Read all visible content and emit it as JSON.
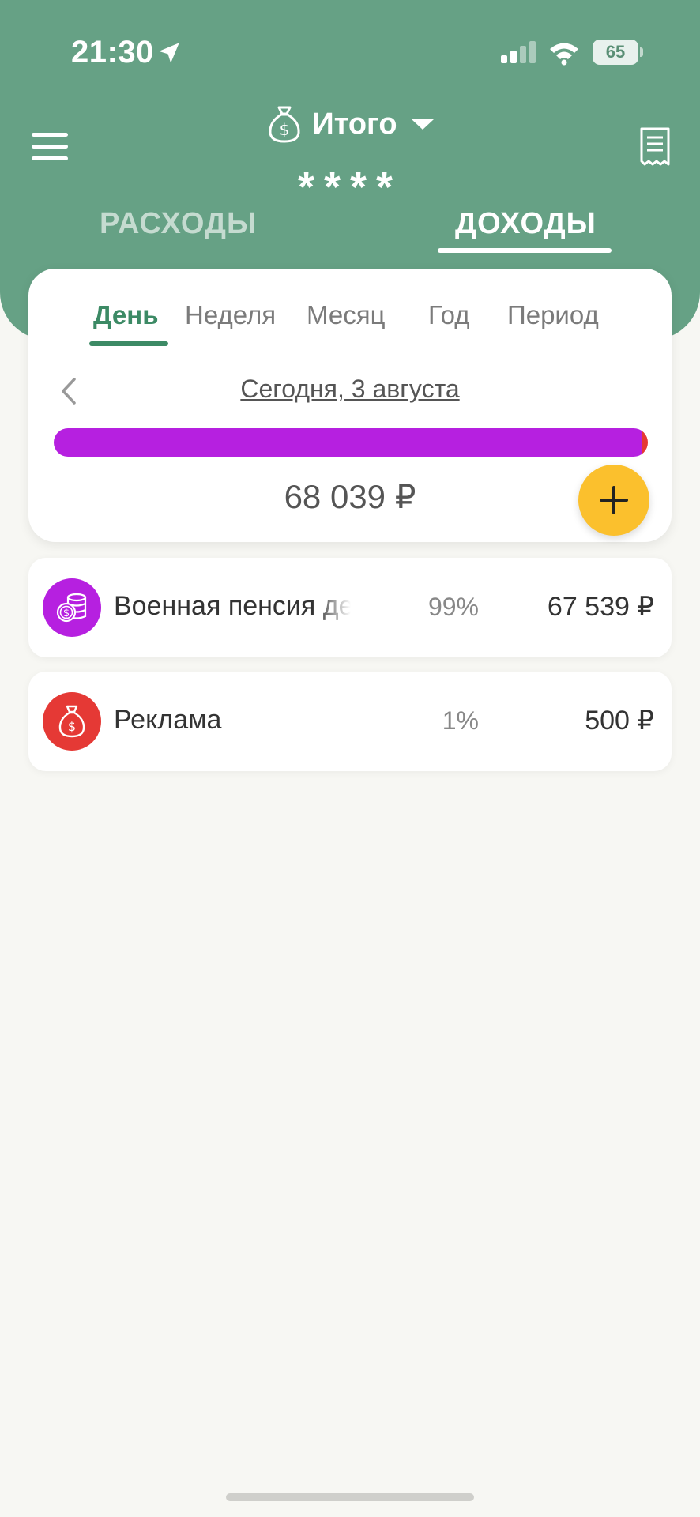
{
  "status_bar": {
    "time": "21:30",
    "battery": "65",
    "icons": [
      "location-arrow-icon",
      "cellular-signal-icon",
      "wifi-icon",
      "battery-icon"
    ]
  },
  "header": {
    "title": "Итого",
    "balance_masked": "****",
    "tabs": [
      {
        "label": "РАСХОДЫ",
        "active": false
      },
      {
        "label": "ДОХОДЫ",
        "active": true
      }
    ],
    "colors": {
      "background": "#66a185",
      "text": "#ffffff"
    }
  },
  "period_tabs": [
    {
      "label": "День",
      "active": true
    },
    {
      "label": "Неделя",
      "active": false
    },
    {
      "label": "Месяц",
      "active": false
    },
    {
      "label": "Год",
      "active": false
    },
    {
      "label": "Период",
      "active": false
    }
  ],
  "date_label": "Сегодня, 3 августа",
  "total": "68 039 ₽",
  "distribution_bar": [
    {
      "category": "Военная пенсия девс",
      "share": 0.99,
      "color": "#b620e0"
    },
    {
      "category": "Реклама",
      "share": 0.01,
      "color": "#e53935"
    }
  ],
  "categories": [
    {
      "name": "Военная пенсия девс",
      "percent": "99%",
      "amount": "67 539 ₽",
      "color": "#b620e0",
      "icon": "coins-stack-icon"
    },
    {
      "name": "Реклама",
      "percent": "1%",
      "amount": "500 ₽",
      "color": "#e53935",
      "icon": "money-bag-icon"
    }
  ],
  "accent_colors": {
    "active_tab": "#3c8a65",
    "fab": "#fbc02d"
  }
}
